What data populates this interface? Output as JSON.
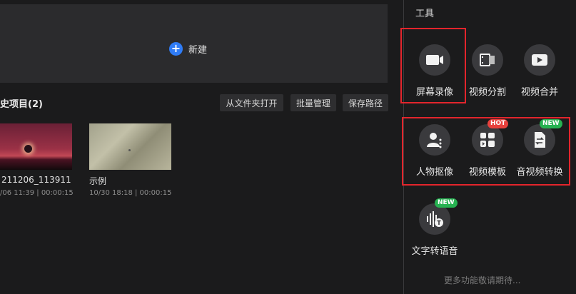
{
  "new_project": {
    "label": "新建"
  },
  "history": {
    "title": "史项目(2)",
    "buttons": [
      "从文件夹打开",
      "批量管理",
      "保存路径"
    ],
    "projects": [
      {
        "name": "211206_113911",
        "meta": "/06 11:39 | 00:00:15"
      },
      {
        "name": "示例",
        "meta": "10/30 18:18 | 00:00:15"
      }
    ]
  },
  "tools": {
    "title": "工具",
    "items": [
      {
        "label": "屏幕录像",
        "icon": "screen-record-icon"
      },
      {
        "label": "视频分割",
        "icon": "video-split-icon"
      },
      {
        "label": "视频合并",
        "icon": "video-merge-icon"
      },
      {
        "label": "人物抠像",
        "icon": "person-cutout-icon"
      },
      {
        "label": "视频模板",
        "icon": "video-template-icon",
        "badge": "HOT"
      },
      {
        "label": "音视频转换",
        "icon": "av-convert-icon",
        "badge": "NEW"
      },
      {
        "label": "文字转语音",
        "icon": "text-to-speech-icon",
        "badge": "NEW"
      }
    ],
    "more": "更多功能敬请期待..."
  },
  "colors": {
    "accent": "#2f7cf6",
    "highlight": "#e3252c",
    "hot_badge": "#e8413d",
    "new_badge": "#26b251"
  }
}
